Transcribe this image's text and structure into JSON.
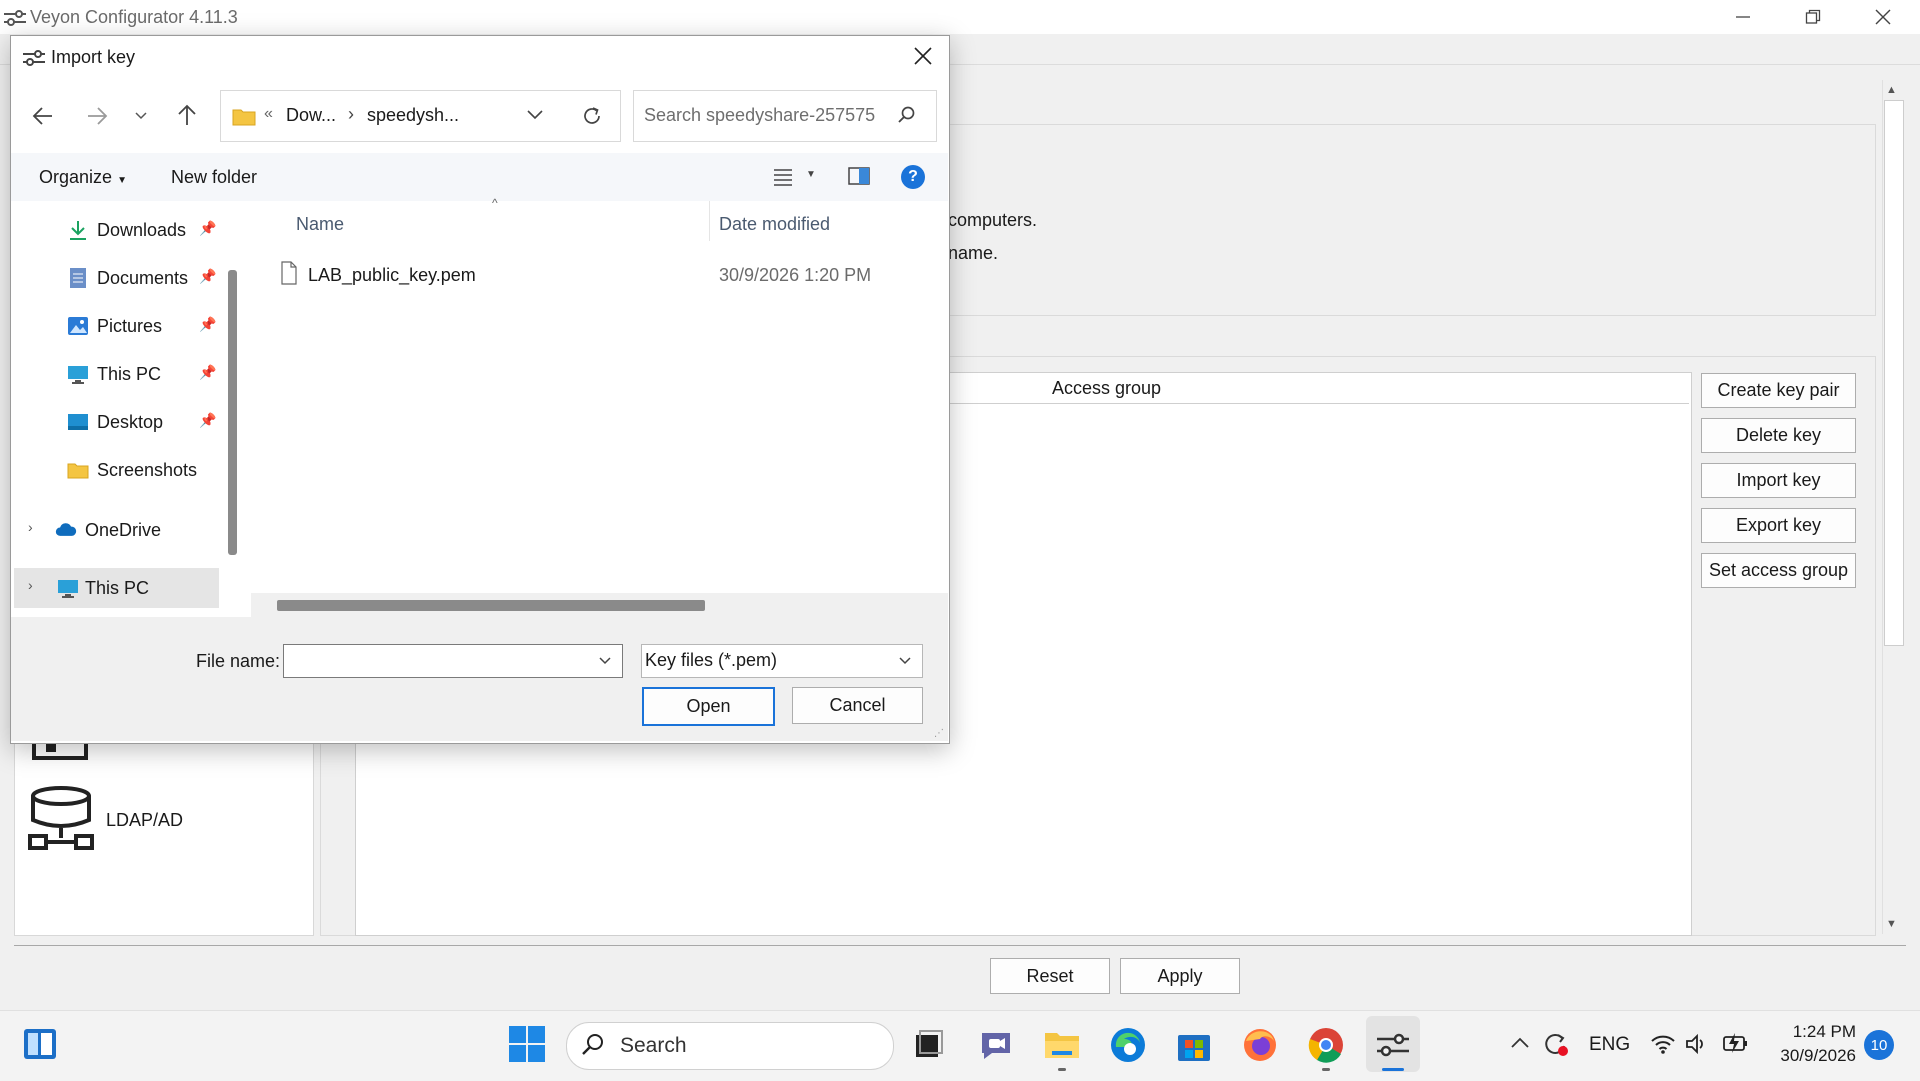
{
  "main_window": {
    "title": "Veyon Configurator 4.11.3",
    "info_line1": "computers.",
    "info_line2": "name.",
    "table_header_access_group": "Access group",
    "buttons": {
      "create_key_pair": "Create key pair",
      "delete_key": "Delete key",
      "import_key": "Import key",
      "export_key": "Export key",
      "set_access_group": "Set access group"
    },
    "sidebar_ldap_label": "LDAP/AD",
    "footer": {
      "reset": "Reset",
      "apply": "Apply"
    }
  },
  "dialog": {
    "title": "Import key",
    "address": {
      "chevrons": "«",
      "part1": "Dow...",
      "separator": "›",
      "part2": "speedysh..."
    },
    "search_placeholder": "Search speedyshare-257575",
    "toolbar": {
      "organize": "Organize",
      "new_folder": "New folder"
    },
    "nav_items": [
      {
        "label": "Downloads",
        "icon": "download-icon",
        "pinned": true
      },
      {
        "label": "Documents",
        "icon": "documents-icon",
        "pinned": true
      },
      {
        "label": "Pictures",
        "icon": "pictures-icon",
        "pinned": true
      },
      {
        "label": "This PC",
        "icon": "monitor-icon",
        "pinned": true
      },
      {
        "label": "Desktop",
        "icon": "desktop-icon",
        "pinned": true
      },
      {
        "label": "Screenshots",
        "icon": "folder-icon",
        "pinned": false
      },
      {
        "label": "OneDrive",
        "icon": "cloud-icon",
        "pinned": false
      },
      {
        "label": "This PC",
        "icon": "monitor-icon",
        "pinned": false,
        "selected": true
      }
    ],
    "columns": {
      "name": "Name",
      "date_modified": "Date modified"
    },
    "files": [
      {
        "name": "LAB_public_key.pem",
        "date_modified": "30/9/2026 1:20 PM"
      }
    ],
    "file_name_label": "File name:",
    "file_name_value": "",
    "filter": "Key files (*.pem)",
    "open": "Open",
    "cancel": "Cancel"
  },
  "taskbar": {
    "search_label": "Search",
    "language": "ENG",
    "time": "1:24 PM",
    "date": "30/9/2026",
    "notification_count": "10"
  },
  "colors": {
    "accent": "#1a73d9",
    "window_bg": "#f0f0f0"
  }
}
